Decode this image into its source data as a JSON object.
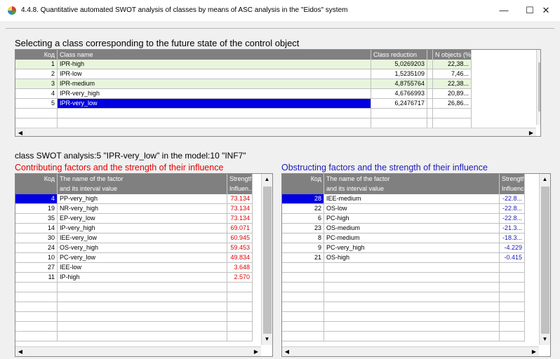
{
  "window": {
    "title": "4.4.8. Quantitative automated SWOT analysis of classes by means of ASC analysis in the \"Eidos\" system",
    "minimize": "—",
    "maximize": "☐",
    "close": "✕"
  },
  "class_section": {
    "heading": "Selecting a class corresponding to the future state of the control object",
    "columns": [
      "Код",
      "Class name",
      "Class reduction",
      "N objects (%)"
    ],
    "rows": [
      {
        "code": "1",
        "name": "IPR-high",
        "reduction": "5,0269203",
        "nobj": "22,38..."
      },
      {
        "code": "2",
        "name": "IPR-low",
        "reduction": "1,5235109",
        "nobj": "7,46..."
      },
      {
        "code": "3",
        "name": "IPR-medium",
        "reduction": "4,8755764",
        "nobj": "22,38..."
      },
      {
        "code": "4",
        "name": "IPR-very_high",
        "reduction": "4,6766993",
        "nobj": "20,89..."
      },
      {
        "code": "5",
        "name": "IPR-very_low",
        "reduction": "6,2476717",
        "nobj": "26,86..."
      }
    ]
  },
  "analysis": {
    "heading": "class SWOT analysis:5 \"IPR-very_low\" in the model:10 \"INF7\"",
    "contributing_title": "Contributing factors and the strength of their influence",
    "obstructing_title": "Obstructing factors and the strength of their influence",
    "columns": {
      "code": "Код",
      "name_line1": "The name of the factor",
      "name_line2": "and its interval value",
      "strength_line1": "Strength",
      "strength_left_line2": "Influen...",
      "strength_right_line2": "Influence"
    },
    "contributing": [
      {
        "code": "4",
        "name": "PP-very_high",
        "value": "73.134"
      },
      {
        "code": "19",
        "name": "NR-very_high",
        "value": "73.134"
      },
      {
        "code": "35",
        "name": "EP-very_low",
        "value": "73.134"
      },
      {
        "code": "14",
        "name": "IP-very_high",
        "value": "69.071"
      },
      {
        "code": "30",
        "name": "IEE-very_low",
        "value": "60.945"
      },
      {
        "code": "24",
        "name": "OS-very_high",
        "value": "59.453"
      },
      {
        "code": "10",
        "name": "PC-very_low",
        "value": "49.834"
      },
      {
        "code": "27",
        "name": "IEE-low",
        "value": "3.648"
      },
      {
        "code": "11",
        "name": "IP-high",
        "value": "2.570"
      }
    ],
    "obstructing": [
      {
        "code": "28",
        "name": "IEE-medium",
        "value": "-22.8..."
      },
      {
        "code": "22",
        "name": "OS-low",
        "value": "-22.8..."
      },
      {
        "code": "6",
        "name": "PC-high",
        "value": "-22.8..."
      },
      {
        "code": "23",
        "name": "OS-medium",
        "value": "-21.3..."
      },
      {
        "code": "8",
        "name": "PC-medium",
        "value": "-18.3..."
      },
      {
        "code": "9",
        "name": "PC-very_high",
        "value": "-4.229"
      },
      {
        "code": "21",
        "name": "OS-high",
        "value": "-0.415"
      }
    ]
  },
  "colors": {
    "contributing": "#e00000",
    "obstructing": "#1a1ab8",
    "selection": "#0000e0",
    "row_green": "#e8f5dc"
  },
  "icons": {
    "scroll_up": "▲",
    "scroll_down": "▼",
    "scroll_left": "◀",
    "scroll_right": "▶"
  }
}
